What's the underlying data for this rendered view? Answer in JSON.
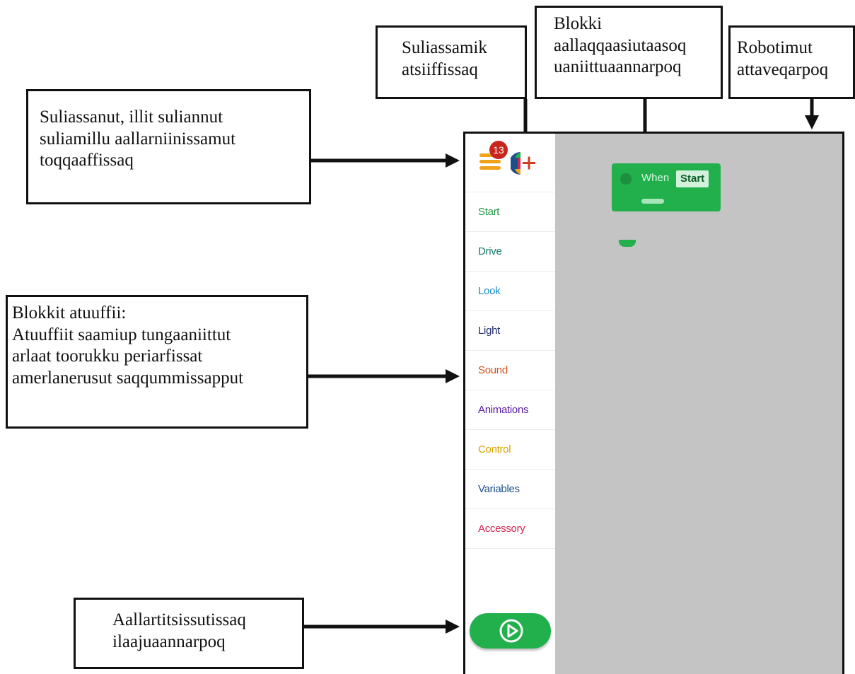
{
  "callouts": {
    "menu": [
      "Suliassanut, illit suliannut",
      "suliamillu aallarniinissamut",
      "toqqaaffissaq"
    ],
    "new_project": [
      "Suliassamik",
      "atsiiffissaq"
    ],
    "start_block": [
      "Blokki",
      "aallaqqaasiutaasoq",
      "uaniittuaannarpoq"
    ],
    "robot": [
      "Robotimut",
      "attaveqarpoq"
    ],
    "blocks": [
      "Blokkit atuuffii:",
      "Atuuffiit saamiup tungaaniittut",
      "arlaat toorukku periarfissat",
      "amerlanerusut saqqummissapput"
    ],
    "run": [
      "Aallartitsissutissaq",
      "ilaajuaannarpoq"
    ]
  },
  "app": {
    "badge_count": "13",
    "categories": [
      {
        "label": "Start",
        "color": "#1f9a45"
      },
      {
        "label": "Drive",
        "color": "#127a6e"
      },
      {
        "label": "Look",
        "color": "#1a8fc4"
      },
      {
        "label": "Light",
        "color": "#1f2a6b"
      },
      {
        "label": "Sound",
        "color": "#d1541e"
      },
      {
        "label": "Animations",
        "color": "#5a1aa0"
      },
      {
        "label": "Control",
        "color": "#d9a400"
      },
      {
        "label": "Variables",
        "color": "#1c4f8a"
      },
      {
        "label": "Accessory",
        "color": "#d02a52"
      }
    ],
    "when_block": {
      "when": "When",
      "event": "Start"
    }
  },
  "colors": {
    "block_green": "#21b04b",
    "badge_red": "#c8261c",
    "menu_orange": "#f0a21a",
    "canvas_gray": "#c4c4c4"
  },
  "icons": [
    "hamburger-menu-icon",
    "add-project-icon",
    "play-icon",
    "robot-avatar-icon"
  ]
}
